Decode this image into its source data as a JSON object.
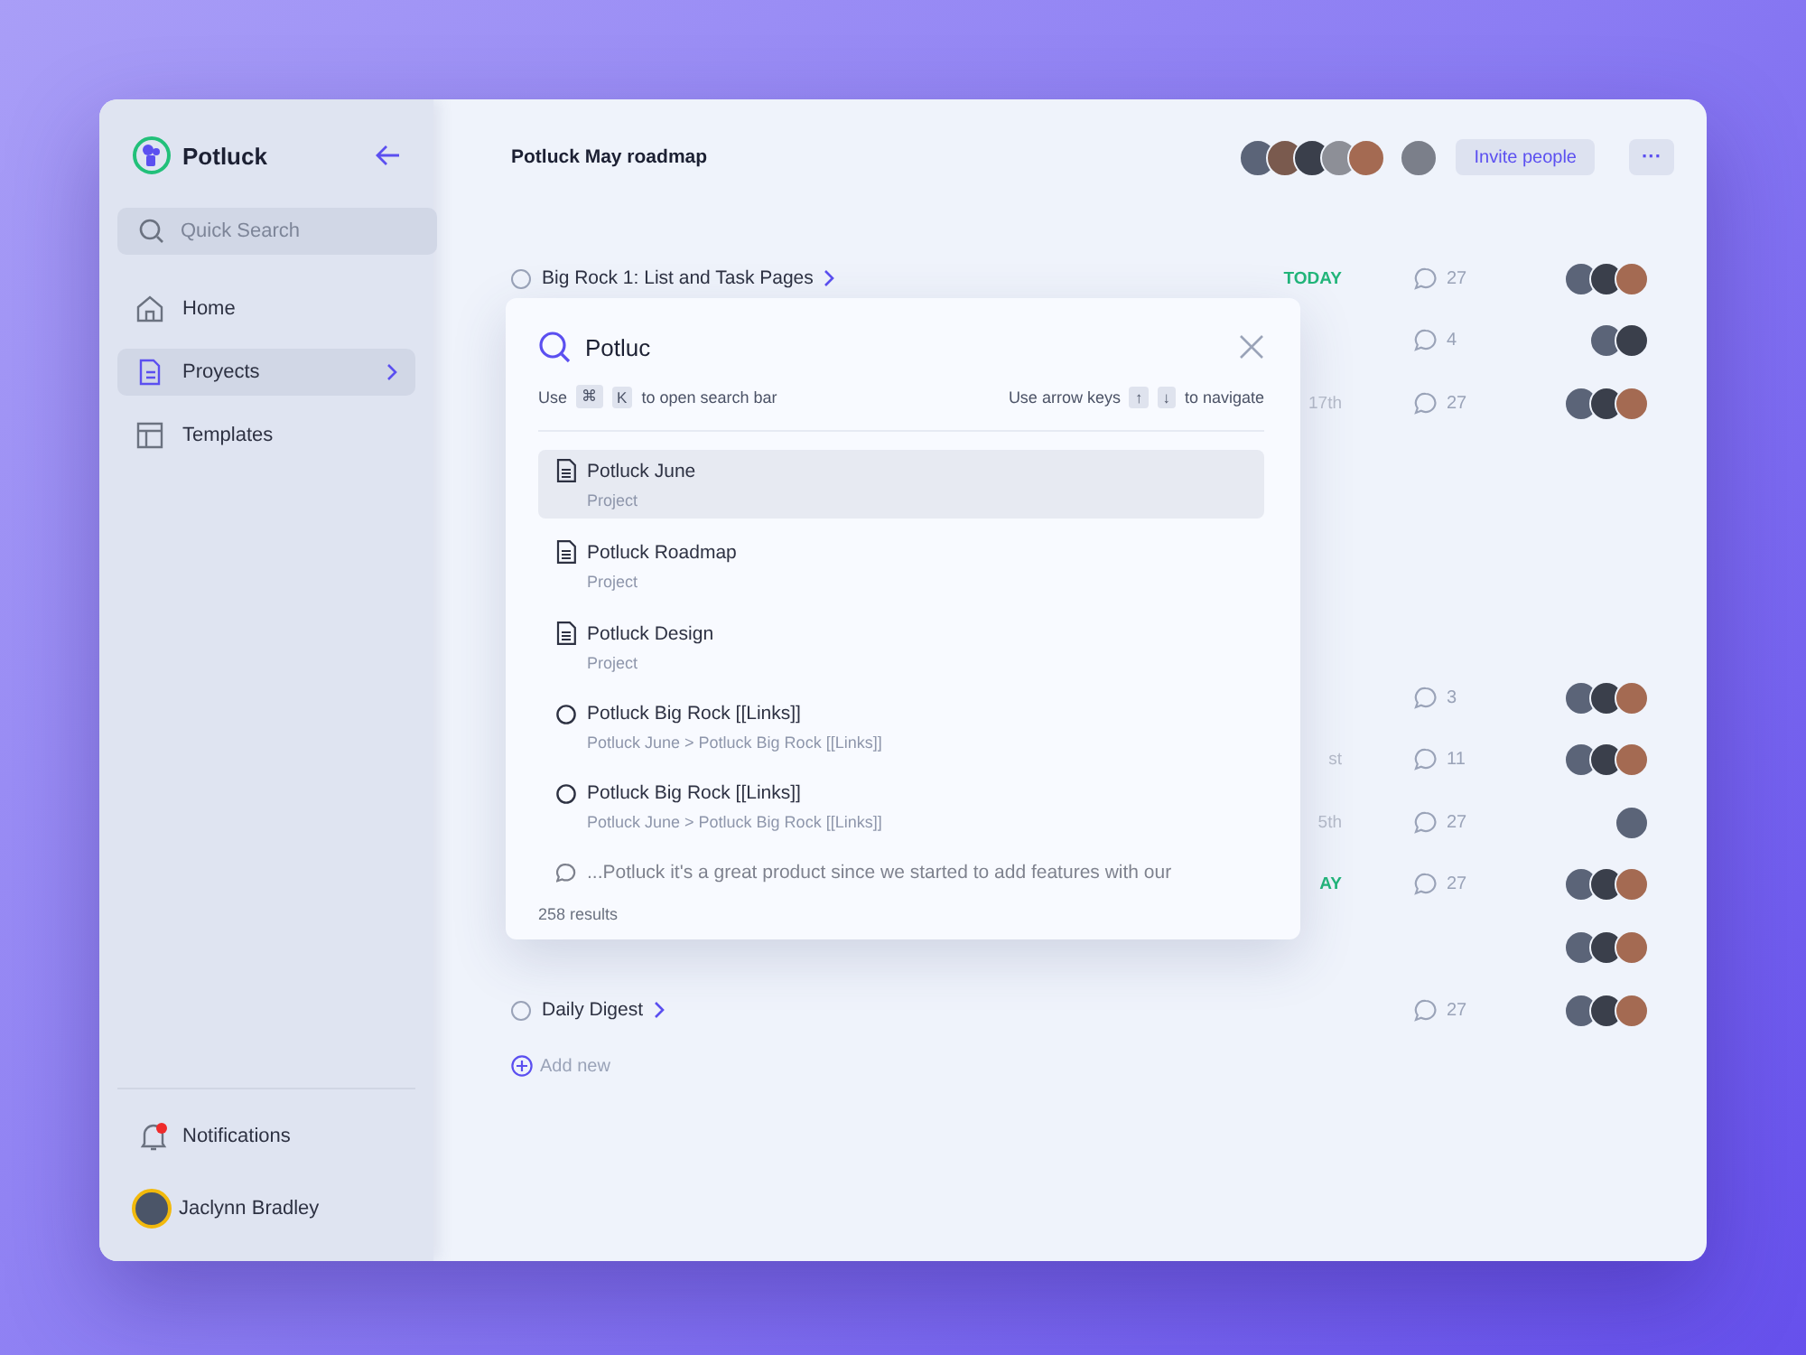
{
  "sidebar": {
    "brand": "Potluck",
    "search": {
      "placeholder": "Quick Search"
    },
    "nav": [
      {
        "label": "Home",
        "kind": "home",
        "selected": false,
        "chevron": false
      },
      {
        "label": "Proyects",
        "kind": "doc",
        "selected": true,
        "chevron": true
      },
      {
        "label": "Templates",
        "kind": "layout",
        "selected": false,
        "chevron": false
      }
    ],
    "notifications": {
      "label": "Notifications",
      "unread": true
    },
    "user": {
      "name": "Jaclynn Bradley"
    }
  },
  "header": {
    "title": "Potluck May roadmap",
    "members": [
      {
        "kind": "photo"
      },
      {
        "kind": "photo"
      },
      {
        "kind": "photo"
      },
      {
        "kind": "photo"
      },
      {
        "kind": "photo"
      }
    ],
    "invite": "Invite people",
    "more": "···"
  },
  "task_groups": [
    [
      {
        "title": "Big Rock 1: List and Task Pages",
        "done": false,
        "chevron": true,
        "date": "TODAY",
        "due_today": true,
        "comments": "27",
        "assignees": [
          {
            "kind": "photo"
          },
          {
            "kind": "photo"
          },
          {
            "kind": "photo"
          }
        ]
      },
      {
        "comments": "4",
        "assignees": [
          {
            "kind": "photo"
          },
          {
            "kind": "photo"
          }
        ]
      },
      {
        "date": "17th",
        "due_today": false,
        "comments": "27",
        "assignees": [
          {
            "kind": "photo"
          },
          {
            "kind": "photo"
          },
          {
            "kind": "photo"
          }
        ]
      }
    ],
    [
      {
        "comments": "3",
        "assignees": [
          {
            "kind": "photo"
          },
          {
            "kind": "photo"
          },
          {
            "kind": "photo"
          }
        ]
      },
      {
        "date": "st",
        "due_today": false,
        "comments": "11",
        "assignees": [
          {
            "kind": "photo"
          },
          {
            "kind": "photo"
          },
          {
            "kind": "photo"
          }
        ]
      },
      {
        "date": "5th",
        "due_today": false,
        "comments": "27",
        "assignees": [
          {
            "kind": "photo"
          }
        ]
      },
      {
        "date": "AY",
        "due_today": true,
        "comments": "27",
        "assignees": [
          {
            "kind": "photo"
          },
          {
            "kind": "photo"
          },
          {
            "kind": "photo"
          }
        ]
      },
      {
        "assignees": [
          {
            "kind": "photo"
          },
          {
            "kind": "photo"
          },
          {
            "kind": "photo"
          }
        ]
      },
      {
        "title": "Daily Digest",
        "done": false,
        "chevron": true,
        "comments": "27",
        "assignees": [
          {
            "kind": "photo"
          },
          {
            "kind": "photo"
          },
          {
            "kind": "photo"
          }
        ]
      }
    ]
  ],
  "add_new": "Add new",
  "search_modal": {
    "query": "Potluc",
    "hint_left": {
      "before": "Use",
      "keys": [
        "⌘",
        "K"
      ],
      "after": "to open search bar"
    },
    "hint_right": {
      "before": "Use arrow keys",
      "keys": [
        "↑",
        "↓"
      ],
      "after": "to navigate"
    },
    "results": [
      {
        "kind": "doc",
        "title": "Potluck June",
        "subtitle": "Project",
        "selected": true
      },
      {
        "kind": "doc",
        "title": "Potluck Roadmap",
        "subtitle": "Project",
        "selected": false
      },
      {
        "kind": "doc",
        "title": "Potluck Design",
        "subtitle": "Project",
        "selected": false
      },
      {
        "kind": "task",
        "title": "Potluck Big Rock [[Links]]",
        "subtitle": "Potluck June > Potluck Big Rock [[Links]]",
        "selected": false
      },
      {
        "kind": "task",
        "title": "Potluck Big Rock [[Links]]",
        "subtitle": "Potluck June > Potluck Big Rock [[Links]]",
        "selected": false
      },
      {
        "kind": "comment",
        "title": "...Potluck it's a great product since we started to add features with our",
        "selected": false
      }
    ],
    "count": "258 results"
  }
}
